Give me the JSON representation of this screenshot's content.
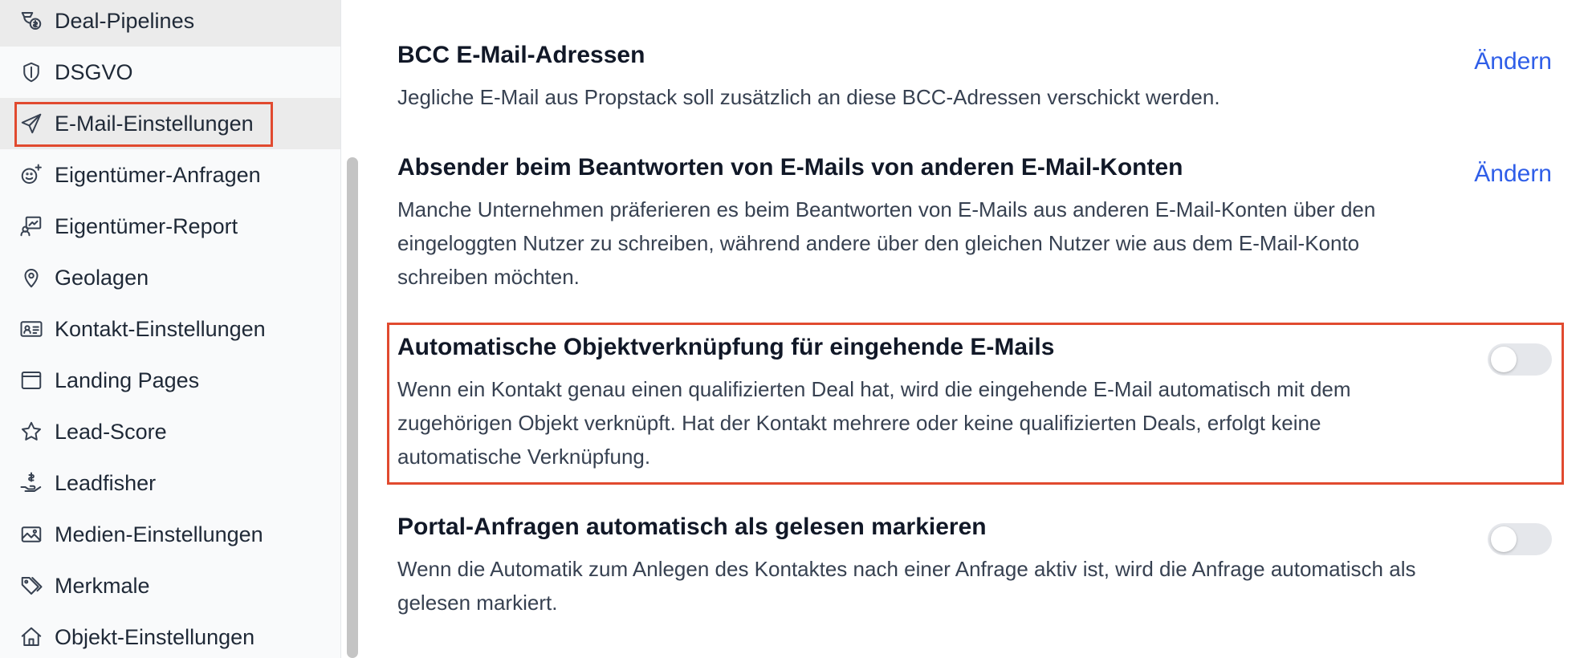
{
  "sidebar": {
    "items": [
      {
        "label": "Deal-Pipelines",
        "icon": "money-pipeline-icon"
      },
      {
        "label": "DSGVO",
        "icon": "shield-icon"
      },
      {
        "label": "E-Mail-Einstellungen",
        "icon": "paper-plane-icon"
      },
      {
        "label": "Eigentümer-Anfragen",
        "icon": "smiley-plus-icon"
      },
      {
        "label": "Eigentümer-Report",
        "icon": "person-chart-icon"
      },
      {
        "label": "Geolagen",
        "icon": "map-pin-icon"
      },
      {
        "label": "Kontakt-Einstellungen",
        "icon": "contact-card-icon"
      },
      {
        "label": "Landing Pages",
        "icon": "browser-window-icon"
      },
      {
        "label": "Lead-Score",
        "icon": "star-icon"
      },
      {
        "label": "Leadfisher",
        "icon": "hand-dollar-icon"
      },
      {
        "label": "Medien-Einstellungen",
        "icon": "image-icon"
      },
      {
        "label": "Merkmale",
        "icon": "tags-icon"
      },
      {
        "label": "Objekt-Einstellungen",
        "icon": "house-icon"
      }
    ]
  },
  "sections": [
    {
      "title": "BCC E-Mail-Adressen",
      "description": "Jegliche E-Mail aus Propstack soll zusätzlich an diese BCC-Adressen verschickt werden.",
      "action": "Ändern"
    },
    {
      "title": "Absender beim Beantworten von E-Mails von anderen E-Mail-Konten",
      "description": "Manche Unternehmen präferieren es beim Beantworten von E-Mails aus anderen E-Mail-Konten über den eingeloggten Nutzer zu schreiben, während andere über den gleichen Nutzer wie aus dem E-Mail-Konto schreiben möchten.",
      "action": "Ändern"
    },
    {
      "title": "Automatische Objektverknüpfung für eingehende E-Mails",
      "description": "Wenn ein Kontakt genau einen qualifizierten Deal hat, wird die eingehende E-Mail automatisch mit dem zugehörigen Objekt verknüpft. Hat der Kontakt mehrere oder keine qualifizierten Deals, erfolgt keine automatische Verknüpfung."
    },
    {
      "title": "Portal-Anfragen automatisch als gelesen markieren",
      "description": "Wenn die Automatik zum Anlegen des Kontaktes nach einer Anfrage aktiv ist, wird die Anfrage automatisch als gelesen markiert."
    }
  ],
  "colors": {
    "accent_link": "#2f5ee8",
    "highlight": "#e14a2f",
    "toggle_off": "#e5e7eb"
  }
}
